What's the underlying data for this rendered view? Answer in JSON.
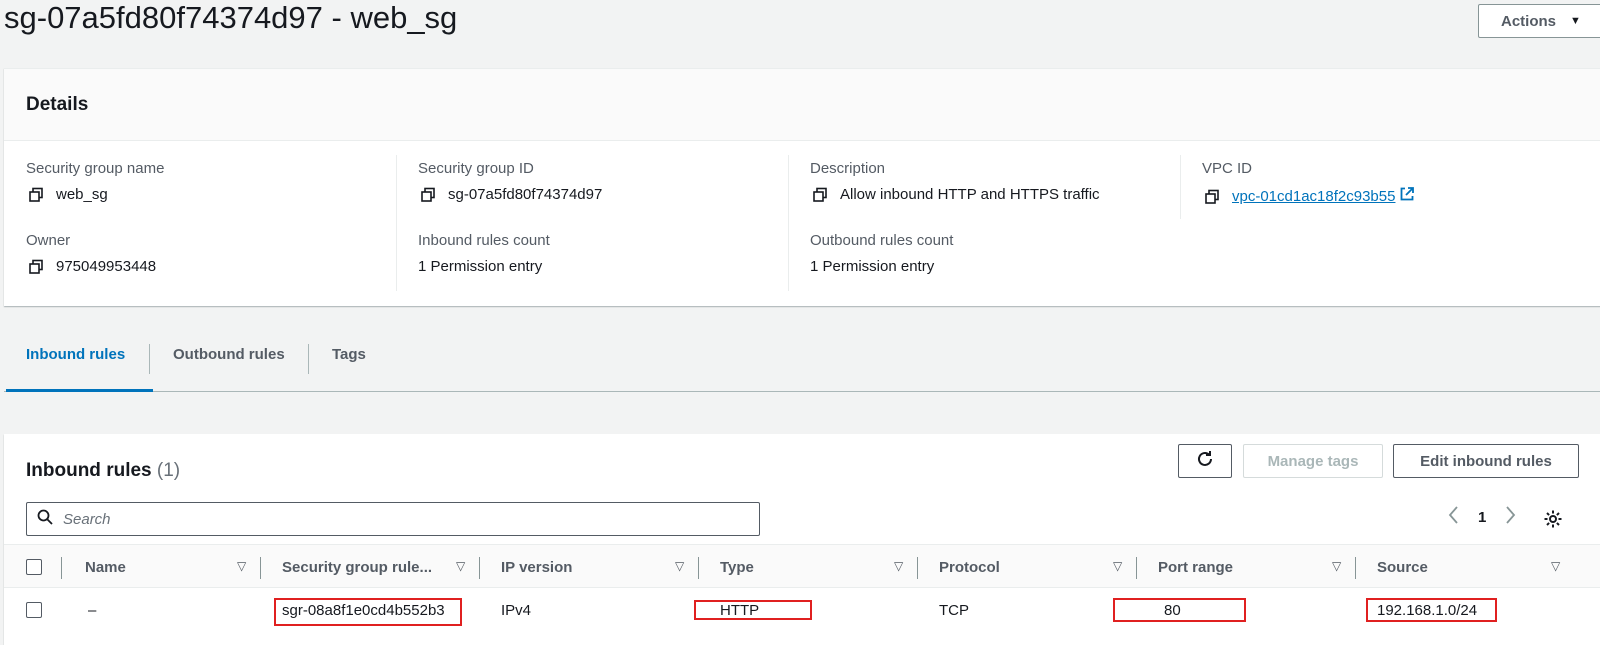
{
  "header": {
    "title": "sg-07a5fd80f74374d97 - web_sg",
    "actions_label": "Actions"
  },
  "details": {
    "heading": "Details",
    "fields": {
      "sg_name": {
        "label": "Security group name",
        "value": "web_sg"
      },
      "sg_id": {
        "label": "Security group ID",
        "value": "sg-07a5fd80f74374d97"
      },
      "description": {
        "label": "Description",
        "value": "Allow inbound HTTP and HTTPS traffic"
      },
      "vpc_id": {
        "label": "VPC ID",
        "value": "vpc-01cd1ac18f2c93b55"
      },
      "owner": {
        "label": "Owner",
        "value": "975049953448"
      },
      "inbound_count": {
        "label": "Inbound rules count",
        "value": "1 Permission entry"
      },
      "outbound_count": {
        "label": "Outbound rules count",
        "value": "1 Permission entry"
      }
    }
  },
  "tabs": [
    {
      "label": "Inbound rules",
      "active": true
    },
    {
      "label": "Outbound rules",
      "active": false
    },
    {
      "label": "Tags",
      "active": false
    }
  ],
  "inbound": {
    "title": "Inbound rules",
    "count": "(1)",
    "manage_tags_label": "Manage tags",
    "edit_label": "Edit inbound rules",
    "search_placeholder": "Search",
    "page": "1",
    "columns": [
      "Name",
      "Security group rule...",
      "IP version",
      "Type",
      "Protocol",
      "Port range",
      "Source"
    ],
    "rows": [
      {
        "name": "–",
        "rule_id": "sgr-08a8f1e0cd4b552b3",
        "ip_version": "IPv4",
        "type": "HTTP",
        "protocol": "TCP",
        "port_range": "80",
        "source": "192.168.1.0/24"
      }
    ]
  },
  "colors": {
    "link": "#0073bb",
    "highlight": "#e02020"
  }
}
